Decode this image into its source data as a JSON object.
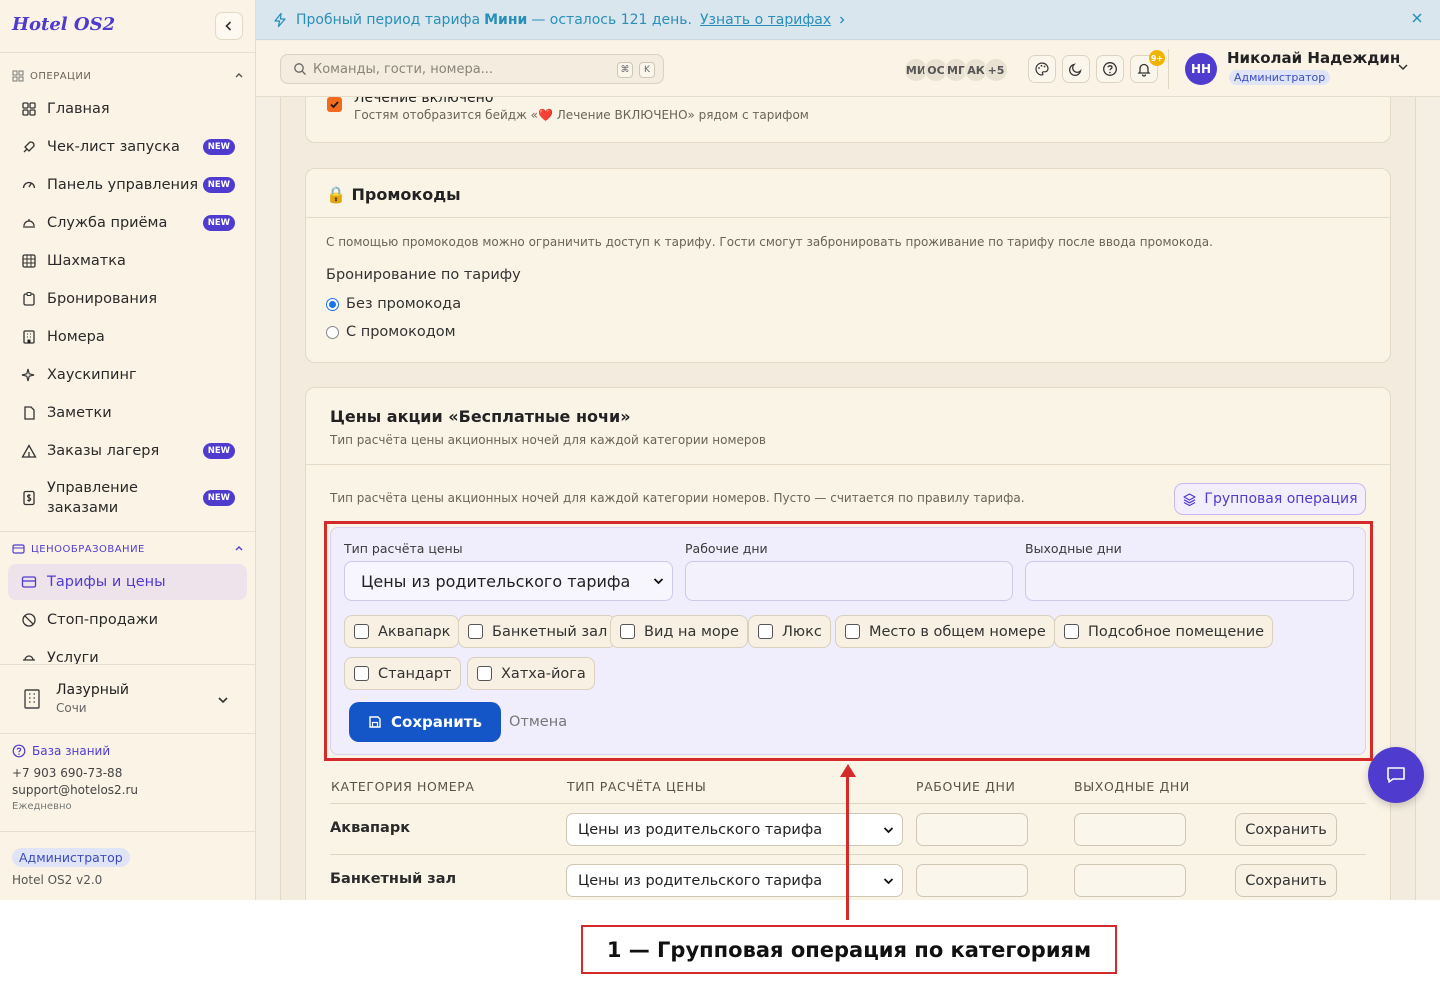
{
  "sidebar": {
    "brand": "Hotel OS2",
    "section_ops": "ОПЕРАЦИИ",
    "section_pricing": "ЦЕНООБРАЗОВАНИЕ",
    "new_badge": "NEW",
    "items": [
      {
        "label": "Главная",
        "icon": "grid-icon",
        "new": false
      },
      {
        "label": "Чек-лист запуска",
        "icon": "rocket-icon",
        "new": true
      },
      {
        "label": "Панель управления",
        "icon": "gauge-icon",
        "new": true
      },
      {
        "label": "Служба приёма",
        "icon": "bell-desk-icon",
        "new": true
      },
      {
        "label": "Шахматка",
        "icon": "table-grid-icon",
        "new": false
      },
      {
        "label": "Бронирования",
        "icon": "clipboard-icon",
        "new": false
      },
      {
        "label": "Номера",
        "icon": "building-icon",
        "new": false
      },
      {
        "label": "Хаускипинг",
        "icon": "sparkles-icon",
        "new": false
      },
      {
        "label": "Заметки",
        "icon": "note-icon",
        "new": false
      },
      {
        "label": "Заказы лагеря",
        "icon": "tent-icon",
        "new": true
      },
      {
        "label_line1": "Управление",
        "label_line2": "заказами",
        "icon": "dollar-doc-icon",
        "new": true
      }
    ],
    "pricing_items": [
      {
        "label": "Тарифы и цены",
        "icon": "card-icon",
        "active": true
      },
      {
        "label": "Стоп-продажи",
        "icon": "ban-icon",
        "active": false
      },
      {
        "label": "Услуги",
        "icon": "service-icon",
        "active": false
      }
    ],
    "hotel": {
      "name": "Лазурный",
      "city": "Сочи"
    },
    "help": {
      "kb": "База знаний",
      "phone": "+7 903 690-73-88",
      "email": "support@hotelos2.ru",
      "schedule": "Ежедневно"
    },
    "role": "Администратор",
    "version": "Hotel OS2 v2.0"
  },
  "banner": {
    "text_before": "Пробный период тарифа",
    "plan": "Мини",
    "text_after": "— осталось 121 день.",
    "link": "Узнать о тарифах",
    "accent": "#2a8fb7"
  },
  "topbar": {
    "search_placeholder": "Команды, гости, номера...",
    "kbd1": "⌘",
    "kbd2": "K",
    "avatars": [
      "МИ",
      "ОС",
      "МГ",
      "АК",
      "+5"
    ],
    "notif_count": "9+",
    "user_initials": "НН",
    "user_name": "Николай Надеждин",
    "user_role": "Администратор"
  },
  "treatment": {
    "label": "Лечение включено",
    "hint": "Гостям отобразится бейдж «❤️ Лечение ВКЛЮЧЕНО» рядом с тарифом",
    "checked": true
  },
  "promo": {
    "title": "🔒 Промокоды",
    "desc": "С помощью промокодов можно ограничить доступ к тарифу. Гости смогут забронировать проживание по тарифу после ввода промокода.",
    "group_label": "Бронирование по тарифу",
    "options": [
      {
        "label": "Без промокода",
        "selected": true
      },
      {
        "label": "С промокодом",
        "selected": false
      }
    ]
  },
  "free_nights": {
    "title": "Цены акции «Бесплатные ночи»",
    "subtitle": "Тип расчёта цены акционных ночей для каждой категории номеров",
    "note": "Тип расчёта цены акционных ночей для каждой категории номеров. Пусто — считается по правилу тарифа.",
    "group_button": "Групповая операция",
    "form": {
      "price_type_label": "Тип расчёта цены",
      "price_type_value": "Цены из родительского тарифа",
      "weekdays_label": "Рабочие дни",
      "weekends_label": "Выходные дни",
      "categories": [
        "Аквапарк",
        "Банкетный зал",
        "Вид на море",
        "Люкс",
        "Место в общем номере",
        "Подсобное помещение",
        "Стандарт",
        "Хатха-йога"
      ],
      "save": "Сохранить",
      "cancel": "Отмена"
    },
    "table": {
      "headers": [
        "КАТЕГОРИЯ НОМЕРА",
        "ТИП РАСЧЁТА ЦЕНЫ",
        "РАБОЧИЕ ДНИ",
        "ВЫХОДНЫЕ ДНИ"
      ],
      "rows": [
        {
          "name": "Аквапарк",
          "type": "Цены из родительского тарифа",
          "save": "Сохранить"
        },
        {
          "name": "Банкетный зал",
          "type": "Цены из родительского тарифа",
          "save": "Сохранить"
        }
      ]
    }
  },
  "annotation": {
    "caption": "1 — Групповая операция по категориям",
    "color": "#d42a2a"
  }
}
